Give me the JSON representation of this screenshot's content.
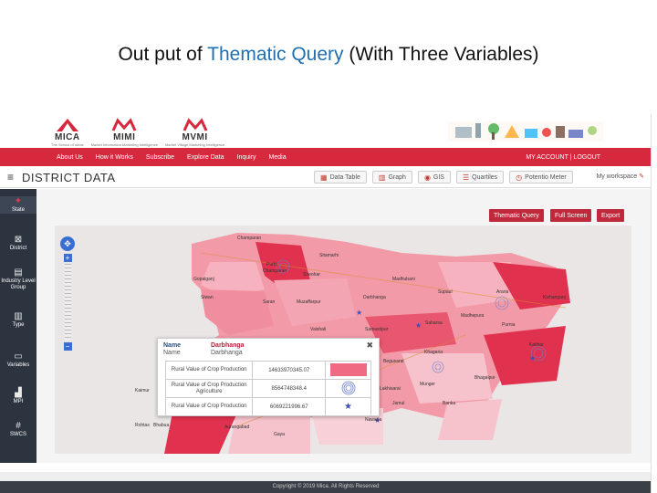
{
  "slide": {
    "title_prefix": "Out put of ",
    "title_highlight": "Thematic Query",
    "title_suffix": " (With Three Variables)"
  },
  "logos": [
    {
      "name": "MICA",
      "sub": "The School of Ideas"
    },
    {
      "name": "MIMI",
      "sub": "Market Information Marketing Intelligence"
    },
    {
      "name": "MVMI",
      "sub": "Market Village Marketing Intelligence"
    }
  ],
  "nav": {
    "items": [
      "About Us",
      "How it Works",
      "Subscribe",
      "Explore Data",
      "Inquiry",
      "Media"
    ],
    "account": "MY ACCOUNT | LOGOUT"
  },
  "header": {
    "title": "DISTRICT DATA",
    "buttons": [
      {
        "label": "Data Table",
        "icon": "table-icon",
        "glyph": "▦"
      },
      {
        "label": "Graph",
        "icon": "graph-icon",
        "glyph": "▥"
      },
      {
        "label": "GIS",
        "icon": "map-pin-icon",
        "glyph": "◉"
      },
      {
        "label": "Quartiles",
        "icon": "list-icon",
        "glyph": "☰"
      },
      {
        "label": "Potentio Meter",
        "icon": "meter-icon",
        "glyph": "◷"
      }
    ],
    "workspace": "My workspace"
  },
  "sidebar": {
    "items": [
      {
        "label": "State",
        "icon": "state-icon",
        "glyph": "✦"
      },
      {
        "label": "District",
        "icon": "district-icon",
        "glyph": "⊠"
      },
      {
        "label": "Industry Level Group",
        "icon": "industry-icon",
        "glyph": "▤"
      },
      {
        "label": "Type",
        "icon": "type-icon",
        "glyph": "▥"
      },
      {
        "label": "Variables",
        "icon": "variables-icon",
        "glyph": "▭"
      },
      {
        "label": "MPI",
        "icon": "mpi-icon",
        "glyph": "▟"
      },
      {
        "label": "SWCS",
        "icon": "swcs-icon",
        "glyph": "#"
      }
    ]
  },
  "map_buttons": [
    "Thematic Query",
    "Full Screen",
    "Export"
  ],
  "map": {
    "places": [
      "Champaran",
      "Purbi Champaran",
      "Sitamarhi",
      "Sheohar",
      "Gopalganj",
      "Siwan",
      "Saran",
      "Muzaffarpur",
      "Darbhanga",
      "Madhubani",
      "Supaul",
      "Araria",
      "Kishanganj",
      "Purnia",
      "Katihar",
      "Vaishali",
      "Samastipur",
      "Saharsa",
      "Madhepura",
      "Khagaria",
      "Begusarai",
      "Bhagalpur",
      "Munger",
      "Lakhisarai",
      "Jamui",
      "Banka",
      "Nawada",
      "Gaya",
      "Aurangabad",
      "Kaimur",
      "Rohtas",
      "Bhabua"
    ]
  },
  "popup": {
    "name_label": "Name",
    "name_value": "Darbhanga",
    "name_label2": "Name",
    "name_value2": "Darbhanga",
    "rows": [
      {
        "label": "Rural Value of Crop Production",
        "value": "14633970345.07",
        "symbol": "fill-swatch"
      },
      {
        "label": "Rural Value of Crop Production Agriculture",
        "value": "8564748348.4",
        "symbol": "concentric-circle"
      },
      {
        "label": "Rural Value of Crop Production",
        "value": "6069221996.67",
        "symbol": "star"
      }
    ]
  },
  "footer": "Copyright © 2019 Mica. All Rights Reserved",
  "colors": {
    "nav": "#d6293e",
    "sidebar": "#2c3440",
    "accent": "#c0283b",
    "link": "#1f6fb2"
  }
}
